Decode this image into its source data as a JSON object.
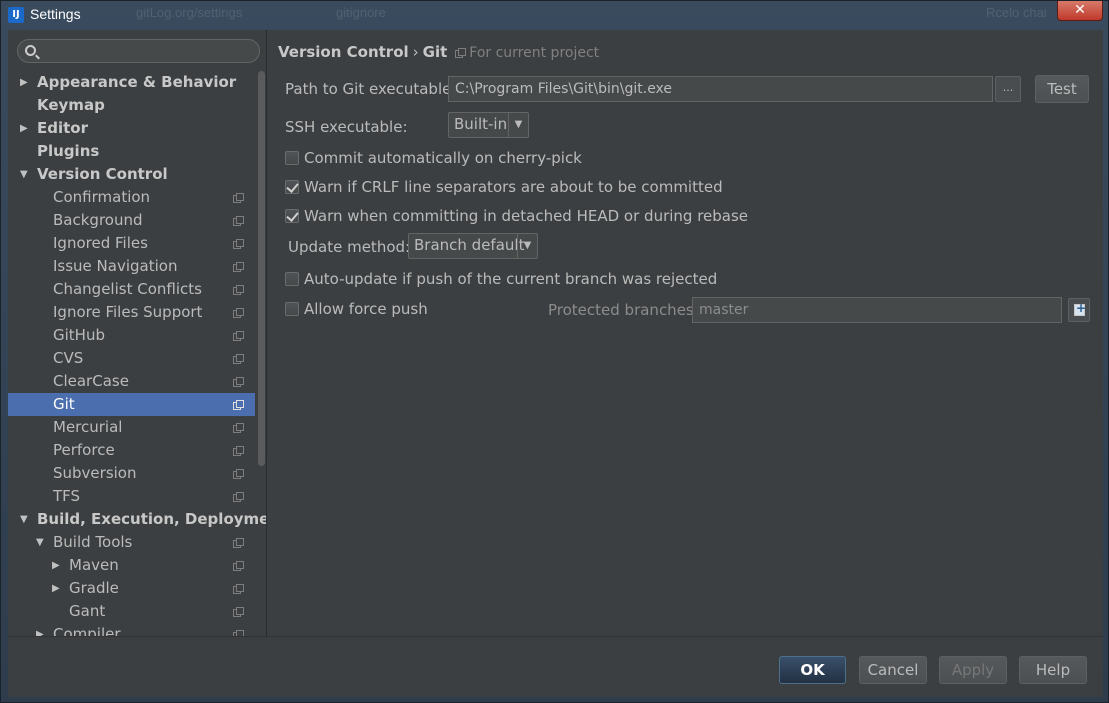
{
  "window": {
    "title": "Settings",
    "close_glyph": "✕",
    "ghost_title_left": "gitLog.org/settings",
    "ghost_title_right": "gitignore",
    "ghost_title_far": "Rcelo chai"
  },
  "search": {
    "placeholder": ""
  },
  "tree": [
    {
      "label": "Appearance & Behavior",
      "level": 0,
      "arrow": "right",
      "bold": true,
      "project": false
    },
    {
      "label": "Keymap",
      "level": 0,
      "arrow": "none",
      "bold": true,
      "project": false
    },
    {
      "label": "Editor",
      "level": 0,
      "arrow": "right",
      "bold": true,
      "project": false
    },
    {
      "label": "Plugins",
      "level": 0,
      "arrow": "none",
      "bold": true,
      "project": false
    },
    {
      "label": "Version Control",
      "level": 0,
      "arrow": "down",
      "bold": true,
      "project": false
    },
    {
      "label": "Confirmation",
      "level": 1,
      "arrow": "none",
      "bold": false,
      "project": true
    },
    {
      "label": "Background",
      "level": 1,
      "arrow": "none",
      "bold": false,
      "project": true
    },
    {
      "label": "Ignored Files",
      "level": 1,
      "arrow": "none",
      "bold": false,
      "project": true
    },
    {
      "label": "Issue Navigation",
      "level": 1,
      "arrow": "none",
      "bold": false,
      "project": true
    },
    {
      "label": "Changelist Conflicts",
      "level": 1,
      "arrow": "none",
      "bold": false,
      "project": true
    },
    {
      "label": "Ignore Files Support",
      "level": 1,
      "arrow": "none",
      "bold": false,
      "project": true
    },
    {
      "label": "GitHub",
      "level": 1,
      "arrow": "none",
      "bold": false,
      "project": true
    },
    {
      "label": "CVS",
      "level": 1,
      "arrow": "none",
      "bold": false,
      "project": true
    },
    {
      "label": "ClearCase",
      "level": 1,
      "arrow": "none",
      "bold": false,
      "project": true
    },
    {
      "label": "Git",
      "level": 1,
      "arrow": "none",
      "bold": false,
      "project": true,
      "selected": true
    },
    {
      "label": "Mercurial",
      "level": 1,
      "arrow": "none",
      "bold": false,
      "project": true
    },
    {
      "label": "Perforce",
      "level": 1,
      "arrow": "none",
      "bold": false,
      "project": true
    },
    {
      "label": "Subversion",
      "level": 1,
      "arrow": "none",
      "bold": false,
      "project": true
    },
    {
      "label": "TFS",
      "level": 1,
      "arrow": "none",
      "bold": false,
      "project": true
    },
    {
      "label": "Build, Execution, Deployment",
      "level": 0,
      "arrow": "down",
      "bold": true,
      "project": false
    },
    {
      "label": "Build Tools",
      "level": 1,
      "arrow": "down",
      "bold": false,
      "project": true
    },
    {
      "label": "Maven",
      "level": 2,
      "arrow": "right",
      "bold": false,
      "project": true
    },
    {
      "label": "Gradle",
      "level": 2,
      "arrow": "right",
      "bold": false,
      "project": true
    },
    {
      "label": "Gant",
      "level": 2,
      "arrow": "none",
      "bold": false,
      "project": true
    },
    {
      "label": "Compiler",
      "level": 1,
      "arrow": "right",
      "bold": false,
      "project": true
    }
  ],
  "breadcrumb": {
    "parent": "Version Control",
    "separator": "›",
    "current": "Git",
    "note": "For current project"
  },
  "git": {
    "path_label": "Path to Git executable:",
    "path_value": "C:\\Program Files\\Git\\bin\\git.exe",
    "browse_label": "...",
    "test_label": "Test",
    "ssh_label": "SSH executable:",
    "ssh_value": "Built-in",
    "commit_cherry_pick": {
      "label": "Commit automatically on cherry-pick",
      "checked": false
    },
    "warn_crlf": {
      "label": "Warn if CRLF line separators are about to be committed",
      "checked": true
    },
    "warn_detached": {
      "label": "Warn when committing in detached HEAD or during rebase",
      "checked": true
    },
    "update_method_label": "Update method:",
    "update_method_value": "Branch default",
    "auto_update": {
      "label": "Auto-update if push of the current branch was rejected",
      "checked": false
    },
    "force_push": {
      "label": "Allow force push",
      "checked": false
    },
    "protected_label": "Protected branches:",
    "protected_value": "master"
  },
  "footer": {
    "ok": "OK",
    "cancel": "Cancel",
    "apply": "Apply",
    "help": "Help"
  },
  "colors": {
    "background": "#3c3f41",
    "selection": "#4b6eaf",
    "text": "#bbbbbb",
    "close": "#c0392b"
  }
}
